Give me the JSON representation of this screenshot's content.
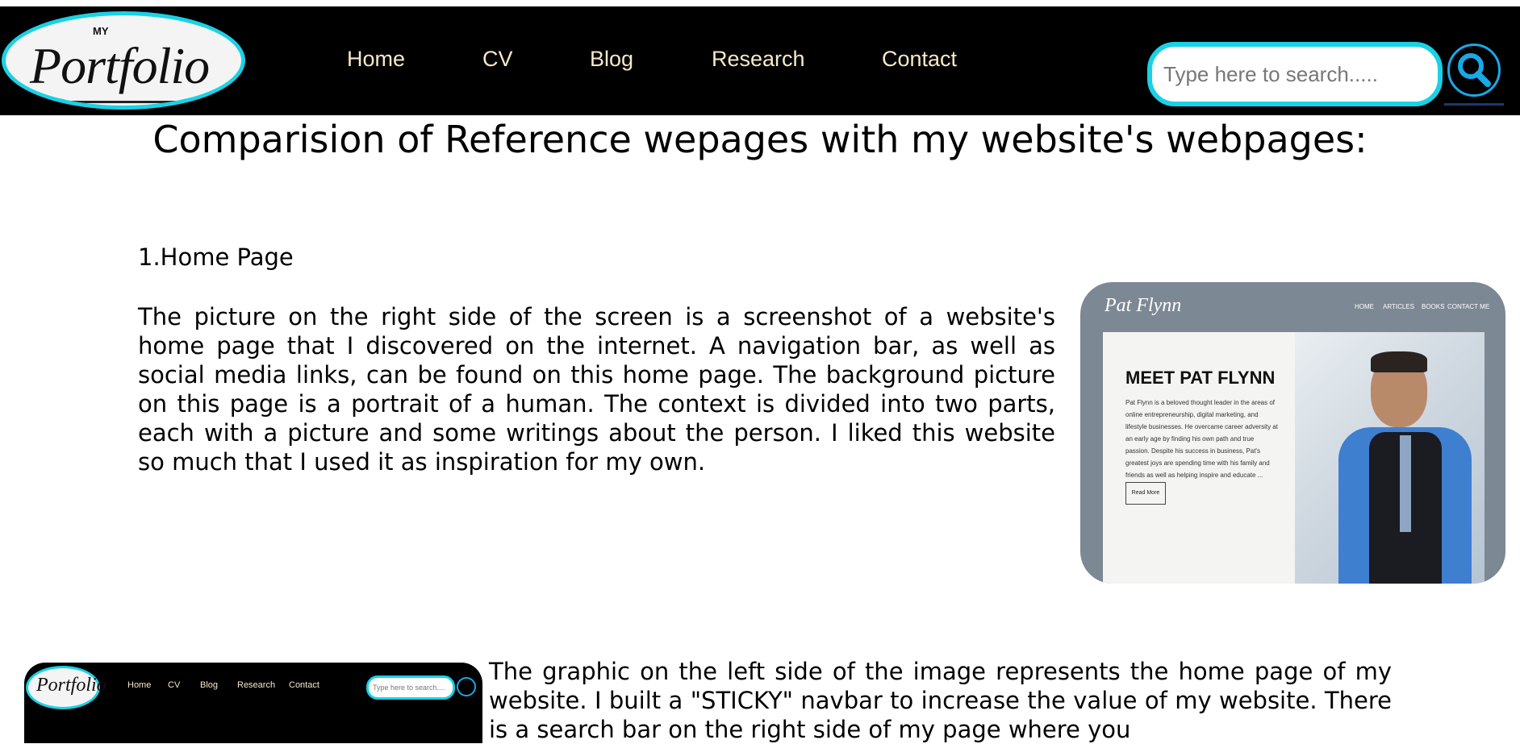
{
  "navbar": {
    "logo_small": "MY",
    "logo_word": "Portfolio",
    "links": [
      "Home",
      "CV",
      "Blog",
      "Research",
      "Contact"
    ],
    "search_placeholder": "Type here to search....."
  },
  "page": {
    "title": "Comparision of Reference wepages with my website's webpages:"
  },
  "sections": [
    {
      "heading": "1.Home Page",
      "paragraph": "The picture on the right side of the screen is a screenshot of a website's home page that I discovered on the internet. A navigation bar, as well as social media links, can be found on this home page. The background picture on this page is a portrait of a human. The context is divided into two parts, each with a picture and some writings about the person. I liked this website so much that I used it as inspiration for my own."
    },
    {
      "paragraph": "The graphic on the left side of the image represents the home page of my website. I built a \"STICKY\" navbar to increase the value of my website. There is a search bar on the right side of my page where you"
    }
  ],
  "reference_screenshot": {
    "logo": "Pat Flynn",
    "nav": [
      "HOME",
      "ARTICLES",
      "BOOKS",
      "CONTACT ME"
    ],
    "heading": "MEET PAT FLYNN",
    "text": "Pat Flynn is a beloved thought leader in the areas of online entrepreneurship, digital marketing, and lifestyle businesses. He overcame career adversity at an early age by finding his own path and true passion. Despite his success in business, Pat's greatest joys are spending time with his family and friends as well as helping inspire and educate ...",
    "button": "Read More"
  },
  "my_screenshot": {
    "logo_word": "Portfolio",
    "nav": [
      "Home",
      "CV",
      "Blog",
      "Research",
      "Contact"
    ],
    "search_placeholder": "Type here to search...."
  }
}
